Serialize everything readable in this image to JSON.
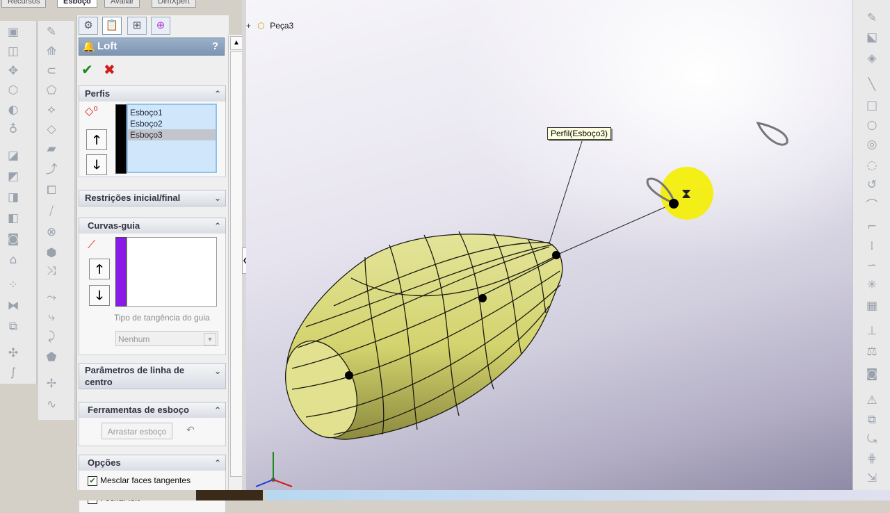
{
  "top_tabs": [
    "Recursos",
    "Esboço",
    "Avaliar",
    "DimXpert"
  ],
  "feature_tree": {
    "part_name": "Peça3"
  },
  "property_manager": {
    "title": "Loft",
    "help": "?",
    "ok_icon": "check-icon",
    "cancel_icon": "close-icon",
    "profiles": {
      "header": "Perfis",
      "items": [
        "Esboço1",
        "Esboço2",
        "Esboço3"
      ],
      "selected_index": 2,
      "up": "🡑",
      "down": "🡓"
    },
    "start_end": {
      "header": "Restrições inicial/final"
    },
    "guide_curves": {
      "header": "Curvas-guia",
      "items": [],
      "up": "🡑",
      "down": "🡓",
      "tangency_label": "Tipo de tangência do guia",
      "tangency_value": "Nenhum"
    },
    "centerline": {
      "header": "Parâmetros de linha de centro"
    },
    "sketch_tools": {
      "header": "Ferramentas de esboço",
      "drag_button": "Arrastar esboço"
    },
    "options": {
      "header": "Opções",
      "merge_tangent": "Mesclar faces tangentes",
      "merge_tangent_checked": true,
      "close_loft": "Fechar loft"
    }
  },
  "viewport": {
    "callout": "Perfil(Esboço3)",
    "triad_icon": "xyz-triad-icon",
    "cursor_icon": "hourglass-icon",
    "colors": {
      "body": "#dede88",
      "wire": "#1a1a10",
      "highlight": "#f5ee00"
    }
  }
}
